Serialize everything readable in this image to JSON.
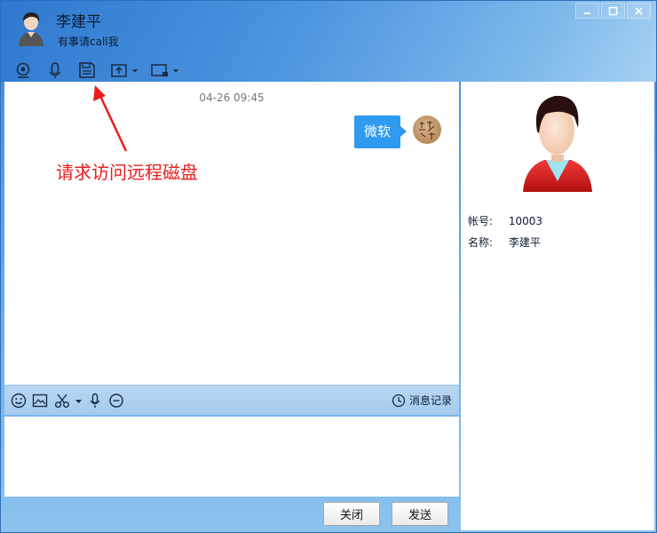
{
  "header": {
    "contact_name": "李建平",
    "status_text": "有事请call我"
  },
  "toolbar": {
    "items": [
      {
        "icon": "camera-icon"
      },
      {
        "icon": "microphone-icon"
      },
      {
        "icon": "floppy-disk-icon"
      },
      {
        "icon": "file-upload-icon"
      },
      {
        "icon": "screen-share-icon"
      }
    ]
  },
  "chat": {
    "timestamp": "04-26 09:45",
    "message_text": "微软",
    "annotation": "请求访问远程磁盘"
  },
  "input_toolbar": {
    "history_label": "消息记录"
  },
  "buttons": {
    "close_label": "关闭",
    "send_label": "发送"
  },
  "profile": {
    "account_key": "帐号:",
    "account_value": "10003",
    "name_key": "名称:",
    "name_value": "李建平"
  },
  "colors": {
    "accent": "#2e9af0",
    "annotation": "#e81e1e"
  }
}
